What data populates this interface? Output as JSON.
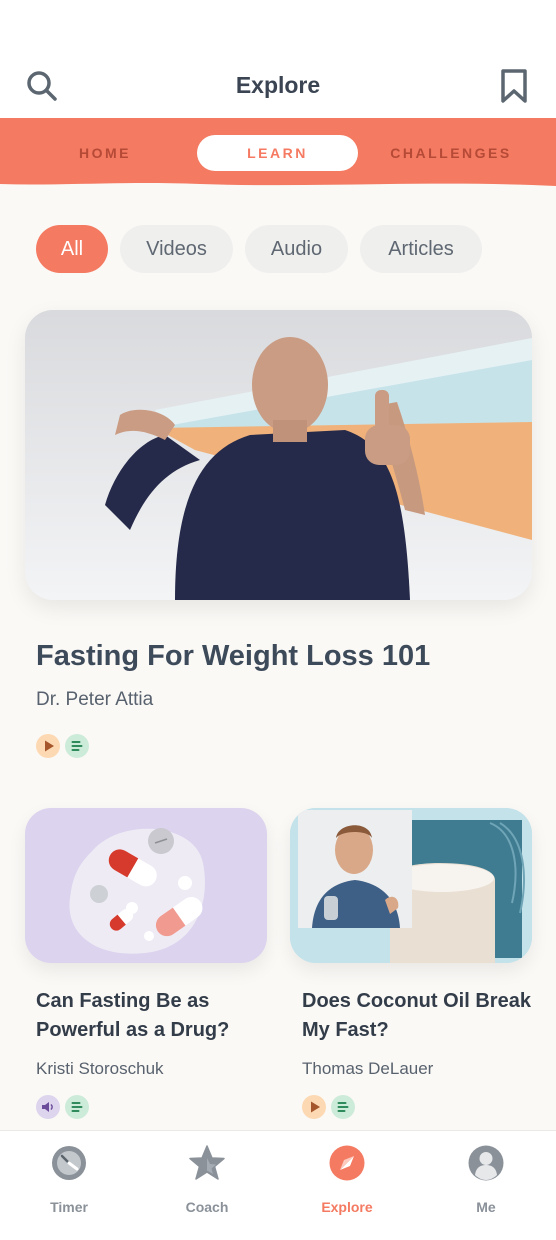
{
  "header": {
    "title": "Explore",
    "search_icon": "search-icon",
    "bookmark_icon": "bookmark-icon"
  },
  "tabs": [
    {
      "label": "HOME",
      "active": false
    },
    {
      "label": "LEARN",
      "active": true
    },
    {
      "label": "CHALLENGES",
      "active": false
    }
  ],
  "filters": [
    {
      "label": "All",
      "active": true
    },
    {
      "label": "Videos",
      "active": false
    },
    {
      "label": "Audio",
      "active": false
    },
    {
      "label": "Articles",
      "active": false
    }
  ],
  "featured": {
    "title": "Fasting For Weight Loss 101",
    "author": "Dr. Peter Attia",
    "media_icons": [
      "video-play-icon",
      "article-lines-icon"
    ]
  },
  "cards": [
    {
      "title": "Can Fasting Be as Powerful as a Drug?",
      "author": "Kristi Storoschuk",
      "media_icons": [
        "audio-speaker-icon",
        "article-lines-icon"
      ]
    },
    {
      "title": "Does Coconut Oil Break My Fast?",
      "author": "Thomas DeLauer",
      "media_icons": [
        "video-play-icon",
        "article-lines-icon"
      ]
    }
  ],
  "bottom_nav": [
    {
      "label": "Timer",
      "icon": "timer-icon",
      "active": false
    },
    {
      "label": "Coach",
      "icon": "star-icon",
      "active": false
    },
    {
      "label": "Explore",
      "icon": "compass-icon",
      "active": true
    },
    {
      "label": "Me",
      "icon": "profile-icon",
      "active": false
    }
  ],
  "colors": {
    "accent": "#f47a61",
    "text_dark": "#3d4a5a",
    "text_muted": "#58626e",
    "chip_bg": "#efefee",
    "video_badge": "#fcd9b2",
    "article_badge": "#cdebd9",
    "audio_badge": "#ddd4ee"
  }
}
